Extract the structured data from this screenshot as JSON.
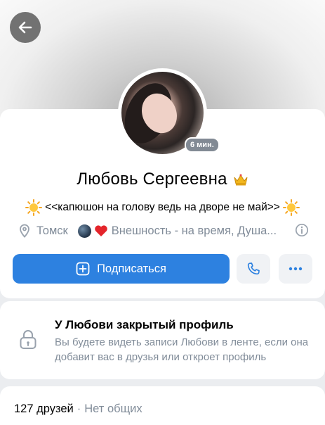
{
  "header": {
    "back_icon": "arrow-left-icon"
  },
  "profile": {
    "name": "Любовь Сергеевна",
    "name_emoji_icon": "crown-icon",
    "online_badge": "6 мин.",
    "status": "<<капюшон на голову ведь на дворе не май>>",
    "status_emoji_icon": "sun-icon",
    "city": "Томск",
    "interests": "Внешность - на время, Душа...",
    "location_icon": "location-pin-icon",
    "info_icon": "info-icon"
  },
  "actions": {
    "subscribe_label": "Подписаться",
    "subscribe_icon": "plus-square-icon",
    "call_icon": "phone-icon",
    "more_icon": "more-horizontal-icon"
  },
  "closed_profile": {
    "title": "У Любови закрытый профиль",
    "description": "Вы будете видеть записи Любови в ленте, если она добавит вас в друзья или откроет профиль",
    "icon": "lock-icon"
  },
  "friends": {
    "count_label": "127 друзей",
    "separator": "·",
    "mutual_label": "Нет общих"
  },
  "colors": {
    "accent": "#2d81e0",
    "secondary_text": "#818c99",
    "background": "#ebedf0"
  }
}
